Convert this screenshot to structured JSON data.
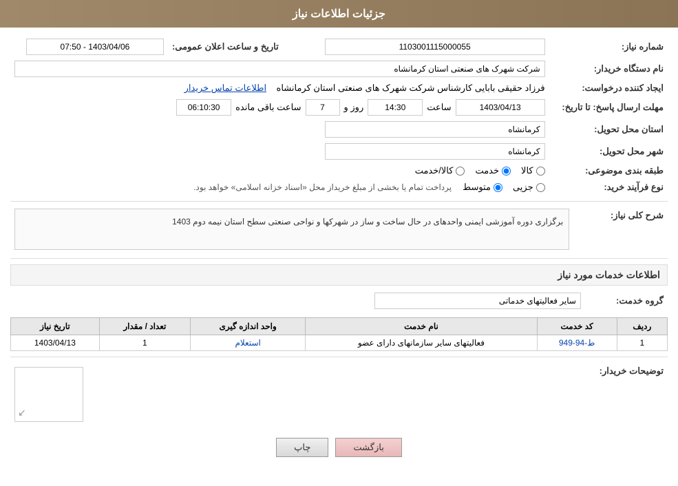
{
  "header": {
    "title": "جزئیات اطلاعات نیاز"
  },
  "fields": {
    "need_number_label": "شماره نیاز:",
    "need_number_value": "1103001115000055",
    "buyer_org_label": "نام دستگاه خریدار:",
    "buyer_org_value": "شرکت شهرک های صنعتی استان کرمانشاه",
    "creator_label": "ایجاد کننده درخواست:",
    "creator_value": "فرزاد حقیقی بابایی کارشناس شرکت شهرک های صنعتی استان کرمانشاه",
    "creator_link": "اطلاعات تماس خریدار",
    "announce_date_label": "تاریخ و ساعت اعلان عمومی:",
    "announce_date_value": "1403/04/06 - 07:50",
    "response_deadline_label": "مهلت ارسال پاسخ: تا تاریخ:",
    "response_date_value": "1403/04/13",
    "response_time_label": "ساعت",
    "response_time_value": "14:30",
    "days_label": "روز و",
    "days_value": "7",
    "remaining_label": "ساعت باقی مانده",
    "remaining_value": "06:10:30",
    "province_label": "استان محل تحویل:",
    "province_value": "کرمانشاه",
    "city_label": "شهر محل تحویل:",
    "city_value": "کرمانشاه",
    "category_label": "طبقه بندی موضوعی:",
    "category_options": [
      "کالا",
      "خدمت",
      "کالا/خدمت"
    ],
    "category_selected": "خدمت",
    "purchase_type_label": "نوع فرآیند خرید:",
    "purchase_type_options": [
      "جزیی",
      "متوسط"
    ],
    "purchase_type_selected": "متوسط",
    "purchase_note": "پرداخت تمام یا بخشی از مبلغ خریداز محل «اسناد خزانه اسلامی» خواهد بود."
  },
  "need_description": {
    "section_title": "شرح کلی نیاز:",
    "text": "برگزاری دوره آموزشی ایمنی واحدهای در حال ساخت و ساز در شهرکها و نواحی صنعتی سطح استان نیمه دوم 1403"
  },
  "services_section": {
    "section_title": "اطلاعات خدمات مورد نیاز",
    "service_group_label": "گروه خدمت:",
    "service_group_value": "سایر فعالیتهای خدماتی",
    "table_headers": [
      "ردیف",
      "کد خدمت",
      "نام خدمت",
      "واحد اندازه گیری",
      "تعداد / مقدار",
      "تاریخ نیاز"
    ],
    "table_rows": [
      {
        "row_num": "1",
        "service_code": "ط-94-949",
        "service_name": "فعالیتهای سایر سازمانهای دارای عضو",
        "unit": "استعلام",
        "quantity": "1",
        "need_date": "1403/04/13"
      }
    ]
  },
  "buyer_description": {
    "label": "توضیحات خریدار:",
    "value": ""
  },
  "buttons": {
    "print": "چاپ",
    "back": "بازگشت"
  }
}
